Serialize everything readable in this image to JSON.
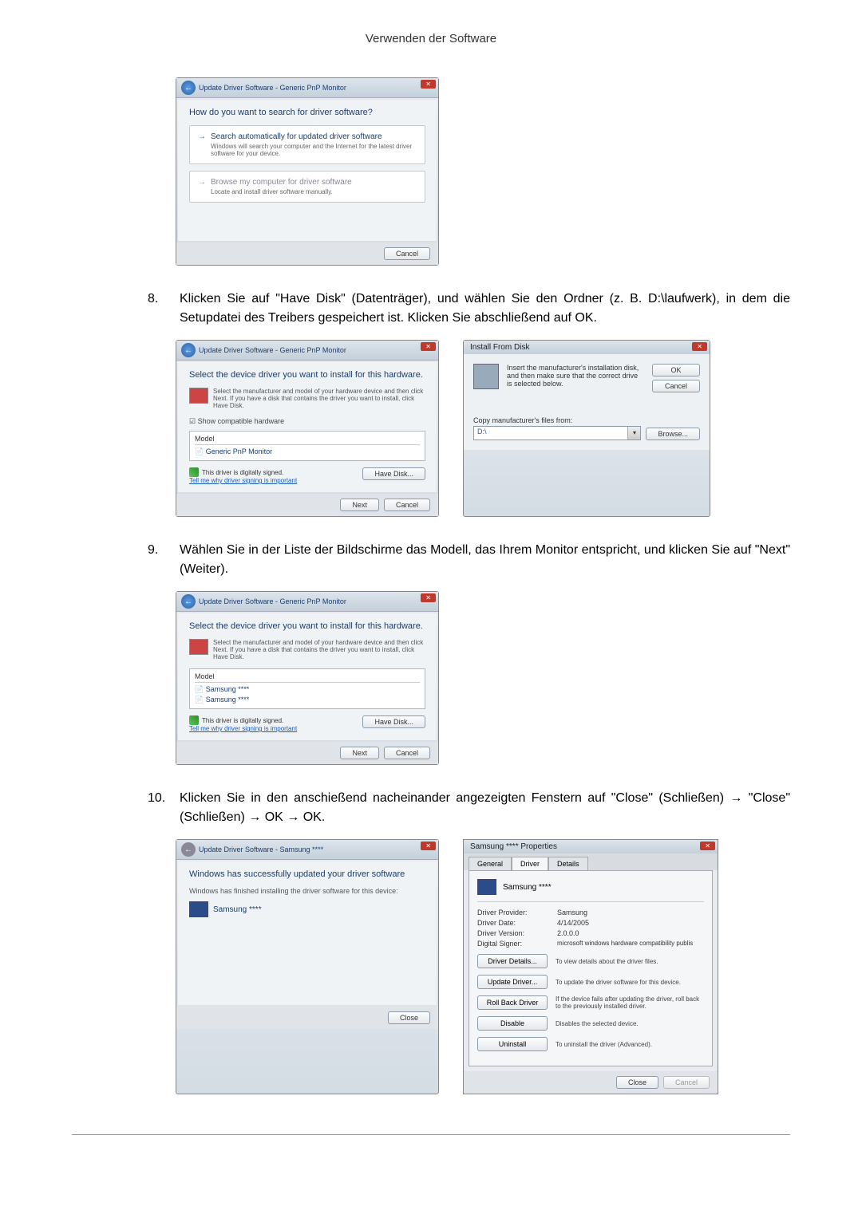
{
  "page_header": "Verwenden der Software",
  "step8": {
    "num": "8.",
    "text": "Klicken Sie auf \"Have Disk\" (Datenträger), und wählen Sie den Ordner (z. B. D:\\laufwerk), in dem die Setupdatei des Treibers gespeichert ist. Klicken Sie abschließend auf OK."
  },
  "step9": {
    "num": "9.",
    "text": "Wählen Sie in der Liste der Bildschirme das Modell, das Ihrem Monitor entspricht, und klicken Sie auf \"Next\" (Weiter)."
  },
  "step10": {
    "num": "10.",
    "text": "Klicken Sie in den anschießend nacheinander angezeigten Fenstern auf \"Close\" (Schließen) → \"Close\" (Schließen) → OK → OK."
  },
  "dlg1": {
    "title": "Update Driver Software - Generic PnP Monitor",
    "heading": "How do you want to search for driver software?",
    "opt1_title": "Search automatically for updated driver software",
    "opt1_desc": "Windows will search your computer and the Internet for the latest driver software for your device.",
    "opt2_title": "Browse my computer for driver software",
    "opt2_desc": "Locate and install driver software manually.",
    "cancel": "Cancel"
  },
  "dlg2": {
    "title": "Update Driver Software - Generic PnP Monitor",
    "heading": "Select the device driver you want to install for this hardware.",
    "instr": "Select the manufacturer and model of your hardware device and then click Next. If you have a disk that contains the driver you want to install, click Have Disk.",
    "chk": "Show compatible hardware",
    "model_hdr": "Model",
    "model_item": "Generic PnP Monitor",
    "signed": "This driver is digitally signed.",
    "link": "Tell me why driver signing is important",
    "have_disk": "Have Disk...",
    "next": "Next",
    "cancel": "Cancel"
  },
  "ifd": {
    "title": "Install From Disk",
    "text": "Insert the manufacturer's installation disk, and then make sure that the correct drive is selected below.",
    "ok": "OK",
    "cancel": "Cancel",
    "label": "Copy manufacturer's files from:",
    "value": "D:\\",
    "browse": "Browse..."
  },
  "dlg3": {
    "title": "Update Driver Software - Generic PnP Monitor",
    "heading": "Select the device driver you want to install for this hardware.",
    "instr": "Select the manufacturer and model of your hardware device and then click Next. If you have a disk that contains the driver you want to install, click Have Disk.",
    "model_hdr": "Model",
    "model1": "Samsung ****",
    "model2": "Samsung ****",
    "signed": "This driver is digitally signed.",
    "link": "Tell me why driver signing is important",
    "have_disk": "Have Disk...",
    "next": "Next",
    "cancel": "Cancel"
  },
  "dlg4": {
    "title": "Update Driver Software - Samsung ****",
    "heading": "Windows has successfully updated your driver software",
    "sub": "Windows has finished installing the driver software for this device:",
    "device": "Samsung ****",
    "close": "Close"
  },
  "prop": {
    "title": "Samsung **** Properties",
    "tab_general": "General",
    "tab_driver": "Driver",
    "tab_details": "Details",
    "device": "Samsung ****",
    "provider_lbl": "Driver Provider:",
    "provider_val": "Samsung",
    "date_lbl": "Driver Date:",
    "date_val": "4/14/2005",
    "version_lbl": "Driver Version:",
    "version_val": "2.0.0.0",
    "signer_lbl": "Digital Signer:",
    "signer_val": "microsoft windows hardware compatibility publis",
    "btn_details": "Driver Details...",
    "btn_details_desc": "To view details about the driver files.",
    "btn_update": "Update Driver...",
    "btn_update_desc": "To update the driver software for this device.",
    "btn_rollback": "Roll Back Driver",
    "btn_rollback_desc": "If the device fails after updating the driver, roll back to the previously installed driver.",
    "btn_disable": "Disable",
    "btn_disable_desc": "Disables the selected device.",
    "btn_uninstall": "Uninstall",
    "btn_uninstall_desc": "To uninstall the driver (Advanced).",
    "close": "Close",
    "cancel": "Cancel"
  }
}
